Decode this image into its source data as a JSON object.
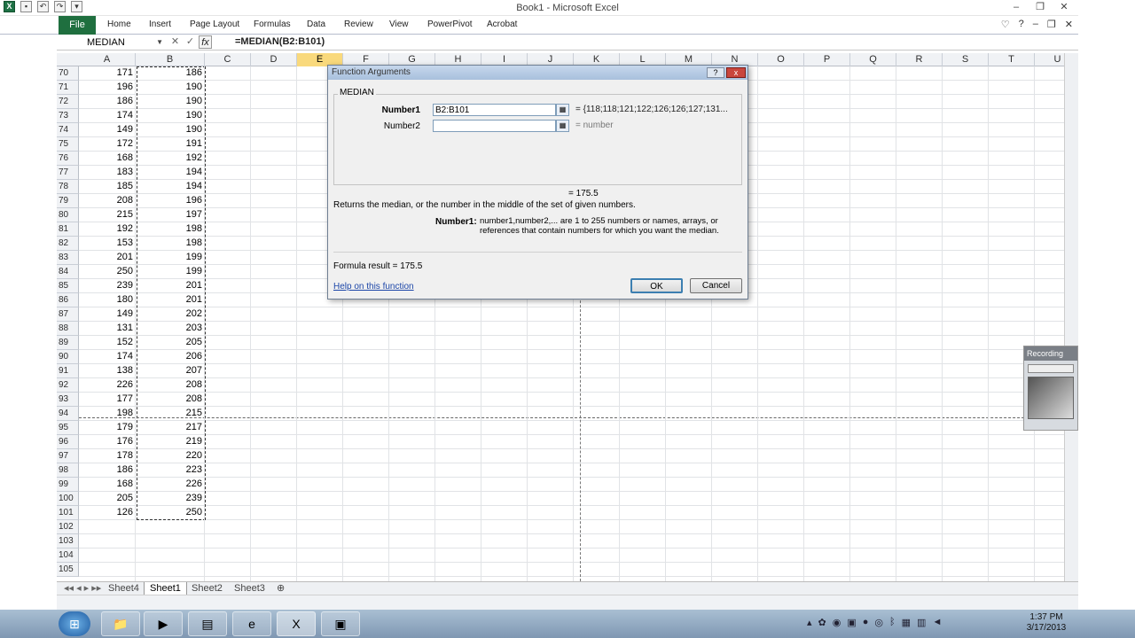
{
  "window": {
    "title": "Book1 - Microsoft Excel"
  },
  "ribbon": {
    "file_label": "File",
    "tabs": [
      "Home",
      "Insert",
      "Page Layout",
      "Formulas",
      "Data",
      "Review",
      "View",
      "PowerPivot",
      "Acrobat"
    ]
  },
  "formula_bar": {
    "name_box": "MEDIAN",
    "formula": "=MEDIAN(B2:B101)",
    "fx_label": "fx"
  },
  "grid": {
    "columns": [
      "A",
      "B",
      "C",
      "D",
      "E",
      "F",
      "G",
      "H",
      "I",
      "J",
      "K",
      "L",
      "M",
      "N",
      "O",
      "P",
      "Q",
      "R",
      "S",
      "T",
      "U"
    ],
    "selected_column": "E",
    "row_numbers": [
      70,
      71,
      72,
      73,
      74,
      75,
      76,
      77,
      78,
      79,
      80,
      81,
      82,
      83,
      84,
      85,
      86,
      87,
      88,
      89,
      90,
      91,
      92,
      93,
      94,
      95,
      96,
      97,
      98,
      99,
      100,
      101,
      102,
      103,
      104,
      105
    ],
    "col_a": [
      171,
      196,
      186,
      174,
      149,
      172,
      168,
      183,
      185,
      208,
      215,
      192,
      153,
      201,
      250,
      239,
      180,
      149,
      131,
      152,
      174,
      138,
      226,
      177,
      198,
      179,
      176,
      178,
      186,
      168,
      205,
      126,
      "",
      "",
      "",
      ""
    ],
    "col_b": [
      186,
      190,
      190,
      190,
      190,
      191,
      192,
      194,
      194,
      196,
      197,
      198,
      198,
      199,
      199,
      201,
      201,
      202,
      203,
      205,
      206,
      207,
      208,
      208,
      215,
      217,
      219,
      220,
      223,
      226,
      239,
      250,
      "",
      "",
      "",
      ""
    ]
  },
  "dialog": {
    "title": "Function Arguments",
    "function_name": "MEDIAN",
    "number1_label": "Number1",
    "number1_value": "B2:B101",
    "number1_result": "= {118;118;121;122;126;126;127;131...",
    "number2_label": "Number2",
    "number2_value": "",
    "number2_result": "= number",
    "result_line": "= 175.5",
    "description": "Returns the median, or the number in the middle of the set of given numbers.",
    "arg_name": "Number1:",
    "arg_description": "number1,number2,... are 1 to 255 numbers or names, arrays, or references that contain numbers for which you want the median.",
    "formula_result": "Formula result =    175.5",
    "help_link": "Help on this function",
    "ok_label": "OK",
    "cancel_label": "Cancel",
    "help_button": "?",
    "close_button": "x"
  },
  "sheet_tabs": [
    "Sheet4",
    "Sheet1",
    "Sheet2",
    "Sheet3"
  ],
  "active_sheet": "Sheet1",
  "recording": {
    "title": "Recording"
  },
  "taskbar": {
    "time": "1:37 PM",
    "date": "3/17/2013"
  }
}
